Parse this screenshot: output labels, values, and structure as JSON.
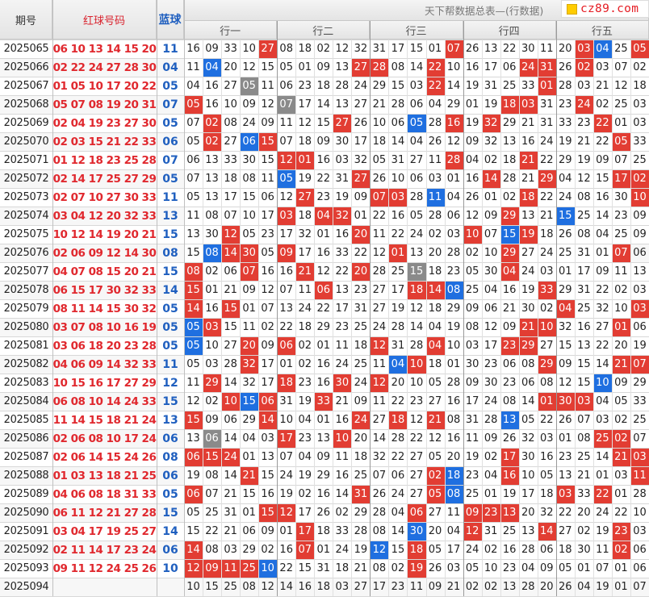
{
  "table_title": "天下帮数据总表—(行数据)",
  "logo_text": "cz89.com",
  "headers": {
    "period": "期号",
    "red": "红球号码",
    "blue": "蓝球"
  },
  "groups": [
    "行一",
    "行二",
    "行三",
    "行四",
    "行五"
  ],
  "colors": {
    "red_hit": "#e23d33",
    "blue_hit": "#1f6fe0",
    "gray_hit": "#8a8a8a",
    "red_text": "#e0282e",
    "blue_text": "#1f5fbf"
  },
  "chart_data": {
    "type": "table",
    "rows": [
      {
        "period": "2025065",
        "red": "06 10 13 14 15 20",
        "blue": "11",
        "cells": "16 09 33 10 27 08 18 02 12 32 31 17 15 01 07 26 13 22 30 11 20 03 04 25 05",
        "marks": "....r.........r......rb.r....."
      },
      {
        "period": "2025066",
        "red": "02 22 24 27 28 30",
        "blue": "04",
        "cells": "11 04 20 12 15 05 01 09 13 27 28 08 14 22 10 16 17 06 24 31 26 02 03 07 02",
        "marks": ".b.......rr..r....rr.r...."
      },
      {
        "period": "2025067",
        "red": "01 05 10 17 20 22",
        "blue": "05",
        "cells": "04 16 27 05 11 06 23 18 28 24 29 15 03 22 14 19 31 25 33 01 28 03 21 12 18",
        "marks": "...g.........r.....r....."
      },
      {
        "period": "2025068",
        "red": "05 07 08 19 20 31",
        "blue": "07",
        "cells": "05 16 10 09 12 07 17 14 13 27 21 28 06 04 29 01 19 18 03 31 23 24 02 25 03",
        "marks": "r....g...........rr..r......"
      },
      {
        "period": "2025069",
        "red": "02 04 19 23 27 30",
        "blue": "05",
        "cells": "07 02 08 24 09 11 12 15 27 26 10 06 05 28 16 19 32 29 21 31 33 23 22 01 03",
        "marks": ".r......r...b.r.r.....r...."
      },
      {
        "period": "2025070",
        "red": "02 03 15 21 22 33",
        "blue": "06",
        "cells": "05 02 27 06 15 07 18 09 30 17 18 14 04 26 12 09 32 13 16 24 19 21 22 05 33",
        "marks": ".r.br..................r.r."
      },
      {
        "period": "2025071",
        "red": "01 12 18 23 25 28",
        "blue": "07",
        "cells": "06 13 33 30 15 12 01 16 03 32 05 31 27 11 28 04 02 18 21 22 29 19 09 07 25",
        "marks": ".....rr.......r...r......br"
      },
      {
        "period": "2025072",
        "red": "02 14 17 25 27 29",
        "blue": "05",
        "cells": "07 13 18 08 11 05 19 22 31 27 26 10 06 03 01 16 14 28 21 29 04 12 15 17 02",
        "marks": ".....b...r......r..r...rr"
      },
      {
        "period": "2025073",
        "red": "02 07 10 27 30 33",
        "blue": "11",
        "cells": "05 13 17 15 06 12 27 23 19 09 07 03 28 11 04 26 01 02 18 22 24 08 16 30 10",
        "marks": "......r...rr.b....r.....rr"
      },
      {
        "period": "2025074",
        "red": "03 04 12 20 32 33",
        "blue": "13",
        "cells": "11 08 07 10 17 03 18 04 32 01 22 16 05 28 06 12 09 29 13 21 15 25 14 23 09",
        "marks": ".....r.rr........r..b..........."
      },
      {
        "period": "2025075",
        "red": "10 12 14 19 20 21",
        "blue": "15",
        "cells": "13 30 12 05 23 17 32 01 16 20 11 22 24 02 03 10 07 15 19 18 26 08 04 25 09",
        "marks": "..r......r.....r.br........."
      },
      {
        "period": "2025076",
        "red": "02 06 09 12 14 30",
        "blue": "08",
        "cells": "15 08 14 30 05 09 17 16 33 22 12 01 13 20 28 02 10 29 27 24 25 31 01 07 06",
        "marks": ".brr.r.....r.....r.....r"
      },
      {
        "period": "2025077",
        "red": "04 07 08 15 20 21",
        "blue": "15",
        "cells": "08 02 06 07 16 16 21 12 22 20 28 25 15 18 23 05 30 04 24 03 01 17 09 11 13",
        "marks": "r..r..r..r..g....r..........."
      },
      {
        "period": "2025078",
        "red": "06 15 17 30 32 33",
        "blue": "14",
        "cells": "15 01 21 09 12 07 11 06 13 23 27 17 18 14 08 25 04 16 19 33 29 31 22 02 03",
        "marks": "r......r....rrb....r....."
      },
      {
        "period": "2025079",
        "red": "08 11 14 15 30 32",
        "blue": "05",
        "cells": "14 16 15 01 07 13 24 22 17 31 27 19 12 18 29 09 06 21 30 02 04 25 32 10 03",
        "marks": "r.r.................r...r.b"
      },
      {
        "period": "2025080",
        "red": "03 07 08 10 16 19",
        "blue": "05",
        "cells": "05 03 15 11 02 22 18 29 23 25 24 28 14 04 19 08 12 09 21 10 32 16 27 01 06",
        "marks": "br................rr...r..r"
      },
      {
        "period": "2025081",
        "red": "03 06 18 20 23 28",
        "blue": "05",
        "cells": "05 10 27 20 09 06 02 01 11 18 12 31 28 04 10 03 17 23 29 27 15 13 22 20 19",
        "marks": "b..r.r....r..r...rr.......r"
      },
      {
        "period": "2025082",
        "red": "04 06 09 14 32 33",
        "blue": "11",
        "cells": "05 03 28 32 17 01 02 16 24 25 11 04 10 18 01 30 23 06 08 29 09 15 14 21 07",
        "marks": "...r.......br......r...rr.r"
      },
      {
        "period": "2025083",
        "red": "10 15 16 17 27 29",
        "blue": "12",
        "cells": "11 29 14 32 17 18 23 16 30 24 12 20 10 05 28 09 30 23 06 08 12 15 10 09 29",
        "marks": ".r...r..r.r...........b.....rr"
      },
      {
        "period": "2025084",
        "red": "06 08 10 14 24 33",
        "blue": "15",
        "cells": "12 02 10 15 06 31 19 33 21 09 11 22 23 27 16 17 24 08 14 01 30 03 04 05 33",
        "marks": "..rbr..r...........rrr......."
      },
      {
        "period": "2025085",
        "red": "11 14 15 18 21 24",
        "blue": "13",
        "cells": "15 09 06 29 14 10 04 01 16 24 27 18 12 21 08 31 28 13 05 22 26 07 03 02 25",
        "marks": "r...r....r.r.r...b........"
      },
      {
        "period": "2025086",
        "red": "02 06 08 10 17 24",
        "blue": "06",
        "cells": "13 06 14 04 03 17 23 13 10 20 14 28 22 12 16 11 09 26 32 03 01 08 25 02 07",
        "marks": ".g...r..r.............rr.r."
      },
      {
        "period": "2025087",
        "red": "02 06 14 15 24 26",
        "blue": "08",
        "cells": "06 15 24 01 13 07 04 09 11 18 32 22 27 05 20 19 02 17 30 16 23 25 14 21 03",
        "marks": "rrr..............r.....rr"
      },
      {
        "period": "2025088",
        "red": "01 03 13 18 21 25",
        "blue": "06",
        "cells": "19 08 14 21 15 24 19 29 16 25 07 06 27 02 18 23 04 16 10 05 13 21 01 03 11",
        "marks": "...r.........rb..r......rrrr."
      },
      {
        "period": "2025089",
        "red": "04 06 08 18 31 33",
        "blue": "05",
        "cells": "06 07 21 15 16 19 02 16 14 31 26 24 27 05 08 25 01 19 17 18 03 33 22 01 28",
        "marks": "r........r...rb.....r.r..."
      },
      {
        "period": "2025090",
        "red": "06 11 12 21 27 28",
        "blue": "15",
        "cells": "05 25 31 01 15 12 17 26 02 29 28 04 06 27 11 09 23 13 20 32 22 20 24 22 10",
        "marks": "....rr......r..rrr........"
      },
      {
        "period": "2025091",
        "red": "03 04 17 19 25 27",
        "blue": "14",
        "cells": "15 22 21 06 09 01 17 18 33 28 08 14 30 20 04 12 31 25 13 14 27 02 19 23 03",
        "marks": "......r.....b..r...r...r..r"
      },
      {
        "period": "2025092",
        "red": "02 11 14 17 23 24",
        "blue": "06",
        "cells": "14 08 03 29 02 16 07 01 24 19 12 15 18 05 17 24 02 16 28 06 18 30 11 02 06",
        "marks": "r.....r...b.r..........r.r"
      },
      {
        "period": "2025093",
        "red": "09 11 12 24 25 26",
        "blue": "10",
        "cells": "12 09 11 25 10 22 15 31 18 21 08 02 19 26 03 05 10 23 04 09 05 01 07 01 06",
        "marks": "rrrrb.......r..............."
      },
      {
        "period": "2025094",
        "red": "",
        "blue": "",
        "cells": "10 15 25 08 12 14 16 18 03 27 17 23 11 09 21 02 02 13 28 20 26 04 19 01 07",
        "marks": ""
      }
    ]
  }
}
